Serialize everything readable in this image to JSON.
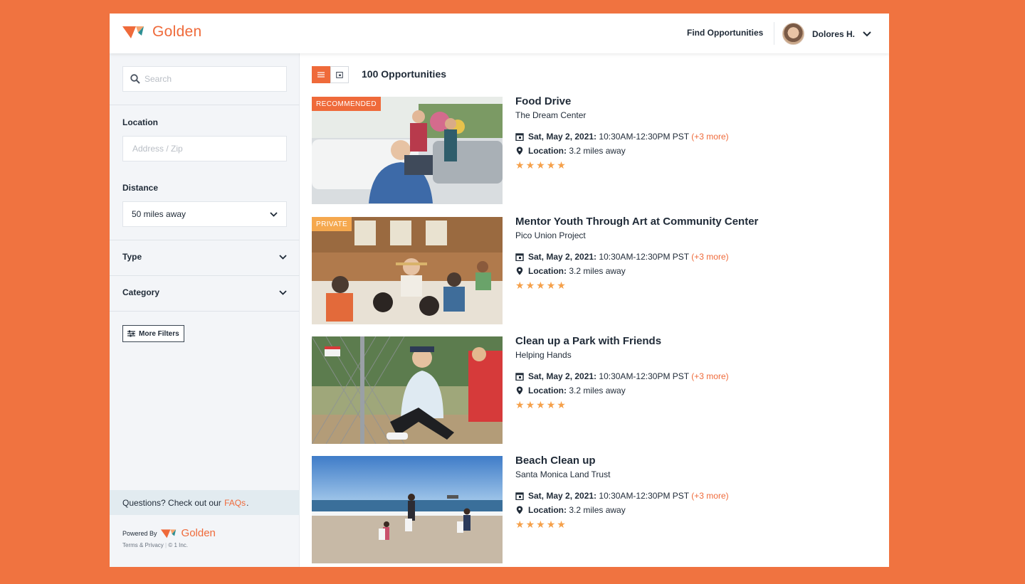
{
  "app": {
    "brand": "Golden",
    "accent": "#EF6A3A"
  },
  "header": {
    "nav_link": "Find Opportunities",
    "user_name": "Dolores H."
  },
  "sidebar": {
    "search_placeholder": "Search",
    "location_label": "Location",
    "location_placeholder": "Address / Zip",
    "distance_label": "Distance",
    "distance_value": "50 miles away",
    "type_label": "Type",
    "category_label": "Category",
    "more_filters": "More Filters",
    "faq_prefix": "Questions? Check out our",
    "faq_link": "FAQs",
    "faq_suffix": ".",
    "powered_by": "Powered By",
    "powered_brand": "Golden",
    "terms": "Terms & Privacy",
    "copyright": "© 1 Inc."
  },
  "main": {
    "count_label": "100 Opportunities",
    "cards": [
      {
        "badge": "RECOMMENDED",
        "title": "Food Drive",
        "org": "The Dream Center",
        "date_label": "Sat, May 2, 2021:",
        "time": "10:30AM-12:30PM PST",
        "more": "(+3 more)",
        "location_label": "Location:",
        "location": "3.2 miles away",
        "rating": 5
      },
      {
        "badge": "PRIVATE",
        "title": "Mentor Youth Through Art at Community Center",
        "org": "Pico Union Project",
        "date_label": "Sat, May 2, 2021:",
        "time": "10:30AM-12:30PM PST",
        "more": "(+3 more)",
        "location_label": "Location:",
        "location": "3.2 miles away",
        "rating": 5
      },
      {
        "badge": "",
        "title": "Clean up a Park with Friends",
        "org": "Helping Hands",
        "date_label": "Sat, May 2, 2021:",
        "time": "10:30AM-12:30PM PST",
        "more": "(+3 more)",
        "location_label": "Location:",
        "location": "3.2 miles away",
        "rating": 5
      },
      {
        "badge": "",
        "title": "Beach Clean up",
        "org": "Santa Monica Land Trust",
        "date_label": "Sat, May 2, 2021:",
        "time": "10:30AM-12:30PM PST",
        "more": "(+3 more)",
        "location_label": "Location:",
        "location": "3.2 miles away",
        "rating": 5
      }
    ]
  }
}
